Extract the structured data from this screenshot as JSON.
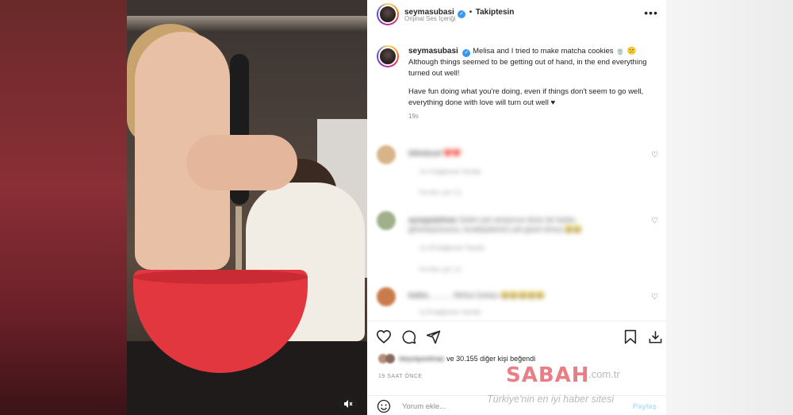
{
  "post": {
    "username": "seymasubasi",
    "follow_label": "Takiptesin",
    "separator": "•",
    "audio_label": "Orijinal Ses İçeriği",
    "more_label": "•••",
    "caption_para1": "Melisa and I tried to make matcha cookies 🍵 😕 Although things seemed to be getting out of hand, in the end everything turned out well!",
    "caption_para2": "Have fun doing what you're doing, even if things don't seem to go well, everything done with love will turn out well ♥",
    "time_ago": "19s",
    "likes_text": "ve 30.155 diğer kişi beğendi",
    "likes_prefix_blurred": "beyzaysolmaz",
    "posted_ago": "19 SAAT ÖNCE",
    "comment_placeholder": "Yorum ekle...",
    "post_button": "Paylaş"
  },
  "comments": [
    {
      "author": "bilinduzal",
      "text": "❤️❤️",
      "meta": "1s   4 beğenme   Yanıtla",
      "replies": "Yanıtları gör (1)",
      "avatar_color": "#d8b48a"
    },
    {
      "author": "aysegulyilmaz",
      "text": "Sizleri çok seviyorum ikiniz de harika görünüyorsunuz, kurabiyeleriniz çok güzel olmuş 😂😂",
      "meta": "1s   20 beğenme   Yanıtla",
      "replies": "Yanıtları gör (1)",
      "avatar_color": "#9fb08a"
    },
    {
      "author": "kubra______",
      "text": "Melisa Şubaşı 😂😂😂😂😂",
      "meta": "1s   8 beğenme   Yanıtla",
      "replies": "",
      "avatar_color": "#c97c4b"
    }
  ],
  "watermark": {
    "logo": "SABAH",
    "domain": ".com.tr",
    "tagline": "Türkiye'nin en iyi haber sitesi"
  },
  "colors": {
    "link_blue": "#3897f0",
    "muted": "#8e8e8e",
    "post_btn": "#b2dffc"
  }
}
